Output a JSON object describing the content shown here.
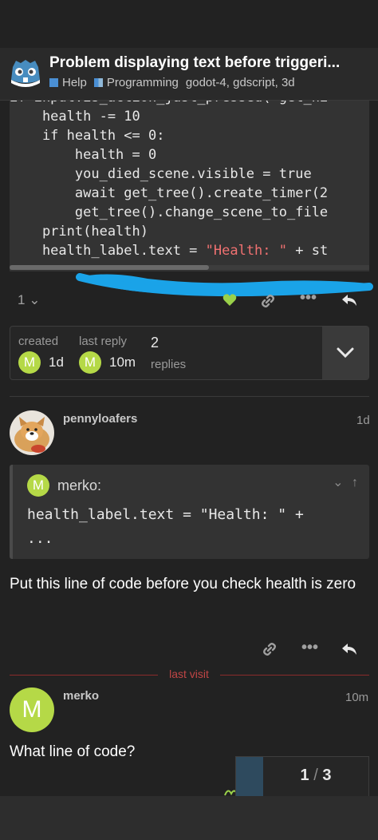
{
  "topic": {
    "title": "Problem displaying text before triggeri...",
    "category_1": "Help",
    "category_2": "Programming",
    "tags": "godot-4, gdscript, 3d"
  },
  "code_block": {
    "lines": [
      "if input.is_action_just_pressed( get_hi",
      "    health -= 10",
      "    if health <= 0:",
      "        health = 0",
      "        you_died_scene.visible = true",
      "        await get_tree().create_timer(2",
      "        get_tree().change_scene_to_file",
      "    print(health)",
      "    health_label.text = "
    ],
    "last_string": "\"Health: \"",
    "last_tail": " + st"
  },
  "post1": {
    "like_count": "1"
  },
  "topic_map": {
    "created_label": "created",
    "created_value": "1d",
    "last_reply_label": "last reply",
    "last_reply_value": "10m",
    "replies_count": "2",
    "replies_label": "replies",
    "avatar_letter": "M"
  },
  "post2": {
    "username": "pennyloafers",
    "date": "1d",
    "quote_author": "merko:",
    "quote_avatar_letter": "M",
    "quote_code_line": "health_label.text = \"Health: \" +",
    "quote_code_ellipsis": "...",
    "body": "Put this line of code before you check health is zero"
  },
  "last_visit_label": "last visit",
  "post3": {
    "username": "merko",
    "date": "10m",
    "avatar_letter": "M",
    "body": "What line of code?"
  },
  "progress": {
    "current": "1",
    "separator": "/",
    "total": "3"
  },
  "colors": {
    "avatar_green": "#b5d947",
    "accent_blue": "#4a8fd4",
    "last_visit_red": "#c04545",
    "scribble_blue": "#1aa3e8"
  }
}
